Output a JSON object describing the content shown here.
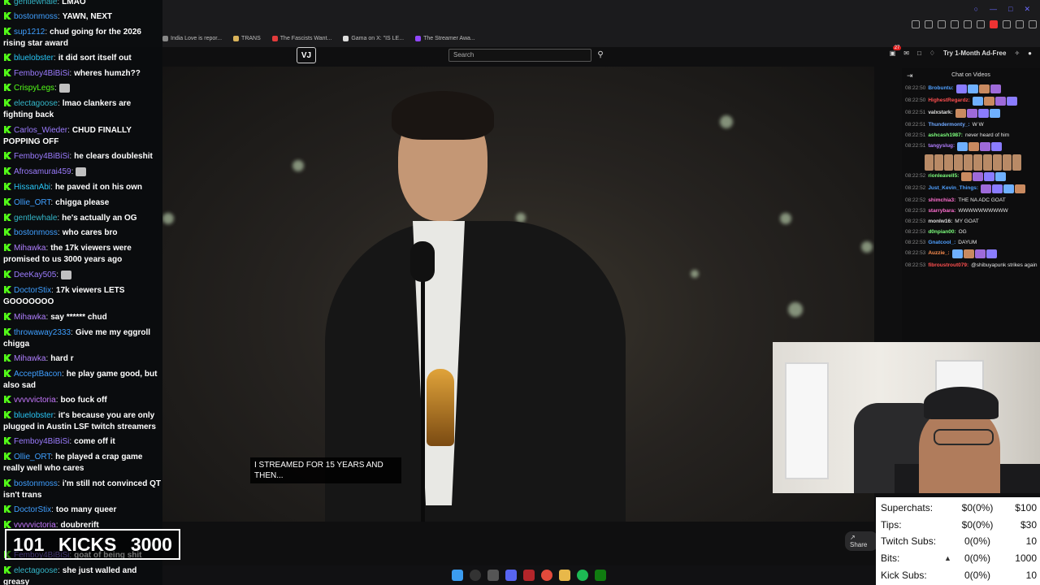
{
  "browser": {
    "bookmarks": [
      "India Love is repor...",
      "TRANS",
      "The Fascists Want...",
      "Gama on X: \"IS LE...",
      "The Streamer Awa..."
    ]
  },
  "header": {
    "logo": "VJ",
    "search_placeholder": "Search",
    "notification_count": "27",
    "ad_free_label": "Try 1-Month Ad-Free"
  },
  "video": {
    "subtitle": "I STREAMED FOR 15 YEARS AND THEN..."
  },
  "video_chat": {
    "title": "Chat on Videos",
    "messages": [
      {
        "time": "08:22:50",
        "user": "Brobuntu:",
        "text": "",
        "color": "#4fa0ff"
      },
      {
        "time": "08:22:50",
        "user": "HighestRegardz:",
        "text": "",
        "color": "#ff4f4f"
      },
      {
        "time": "08:22:51",
        "user": "valxstark:",
        "text": "",
        "color": "#e0e0e0"
      },
      {
        "time": "08:22:51",
        "user": "Thundermonty_:",
        "text": "W W",
        "color": "#6fa8ff"
      },
      {
        "time": "08:22:51",
        "user": "ashcash1987:",
        "text": "never heard of him",
        "color": "#7dff7d"
      },
      {
        "time": "08:22:51",
        "user": "tangyslug:",
        "text": "",
        "color": "#b27dff"
      },
      {
        "time": "08:22:52",
        "user": "rionleavell5:",
        "text": "",
        "color": "#7dff7d"
      },
      {
        "time": "08:22:52",
        "user": "Just_Kevin_Things:",
        "text": "",
        "color": "#4fa0ff"
      },
      {
        "time": "08:22:52",
        "user": "shimchia3:",
        "text": "THE NA ADC GOAT",
        "color": "#ff6fd0"
      },
      {
        "time": "08:22:53",
        "user": "starrybara:",
        "text": "WWWWWWWWWW",
        "color": "#ff6fd0"
      },
      {
        "time": "08:22:53",
        "user": "monlw16:",
        "text": "MY GOAT",
        "color": "#e0e0e0"
      },
      {
        "time": "08:22:53",
        "user": "d0npian00:",
        "text": "OG",
        "color": "#7dff7d"
      },
      {
        "time": "08:22:53",
        "user": "Gnatcool_:",
        "text": "DAYUM",
        "color": "#4fa0ff"
      },
      {
        "time": "08:22:53",
        "user": "Auzzie_:",
        "text": "",
        "color": "#ff8f4f"
      },
      {
        "time": "08:22:53",
        "user": "fibroustrout079:",
        "text": "@shibuyapunk strikes again",
        "color": "#ff4f4f"
      }
    ]
  },
  "left_chat": {
    "messages": [
      {
        "user": "gentlewhale",
        "text": "LMAO",
        "cls": "u-teal"
      },
      {
        "user": "bostonmoss",
        "text": "YAWN, NEXT",
        "cls": "u-blue"
      },
      {
        "user": "sup1212",
        "text": "chud going for the 2026 rising star award",
        "cls": "u-blue"
      },
      {
        "user": "bluelobster",
        "text": "it did sort itself out",
        "cls": "u-cyan"
      },
      {
        "user": "Femboy4BiBiSi",
        "text": "wheres humzh??",
        "cls": "u-purple"
      },
      {
        "user": "CrispyLegs",
        "text": "",
        "cls": "u-green"
      },
      {
        "user": "electagoose",
        "text": "lmao clankers are fighting back",
        "cls": "u-teal"
      },
      {
        "user": "Carlos_Wieder",
        "text": "CHUD FINALLY POPPING OFF",
        "cls": "u-purple"
      },
      {
        "user": "Femboy4BiBiSi",
        "text": "he clears doubleshit",
        "cls": "u-purple"
      },
      {
        "user": "Afrosamurai459",
        "text": "",
        "cls": "u-purple"
      },
      {
        "user": "HissanAbi",
        "text": "he paved it on his own",
        "cls": "u-cyan"
      },
      {
        "user": "Ollie_ORT",
        "text": "chigga please",
        "cls": "u-blue"
      },
      {
        "user": "gentlewhale",
        "text": "he's actually an OG",
        "cls": "u-teal"
      },
      {
        "user": "bostonmoss",
        "text": "who cares bro",
        "cls": "u-blue"
      },
      {
        "user": "Mihawka",
        "text": "the 17k viewers were promised to us 3000 years ago",
        "cls": "u-violet"
      },
      {
        "user": "DeeKay505",
        "text": "",
        "cls": "u-purple"
      },
      {
        "user": "DoctorStix",
        "text": "17k viewers LETS GOOOOOOO",
        "cls": "u-blue"
      },
      {
        "user": "Mihawka",
        "text": "say ****** chud",
        "cls": "u-violet"
      },
      {
        "user": "throwaway2333",
        "text": "Give me my eggroll chigga",
        "cls": "u-blue"
      },
      {
        "user": "Mihawka",
        "text": "hard r",
        "cls": "u-violet"
      },
      {
        "user": "AcceptBacon",
        "text": "he play game good, but also sad",
        "cls": "u-blue"
      },
      {
        "user": "vvvvvictoria",
        "text": "boo fuck off",
        "cls": "u-mag"
      },
      {
        "user": "bluelobster",
        "text": "it's because you are only plugged in Austin LSF twitch streamers",
        "cls": "u-cyan"
      },
      {
        "user": "Femboy4BiBiSi",
        "text": "come off it",
        "cls": "u-purple"
      },
      {
        "user": "Ollie_ORT",
        "text": "he played a crap game really well who cares",
        "cls": "u-blue"
      },
      {
        "user": "bostonmoss",
        "text": "i'm still not convinced QT isn't trans",
        "cls": "u-blue"
      },
      {
        "user": "DoctorStix",
        "text": "too many queer",
        "cls": "u-blue"
      },
      {
        "user": "vvvvvictoria",
        "text": "doubrerift",
        "cls": "u-mag"
      },
      {
        "user": "Femboy4BiBiSi",
        "text": "goat of being shit",
        "cls": "u-purple"
      },
      {
        "user": "electagoose",
        "text": "she just walled and greasy",
        "cls": "u-teal"
      }
    ]
  },
  "kicks": {
    "current": "101",
    "label": "KICKS",
    "goal": "3000"
  },
  "bottom": {
    "share_label": "Share"
  },
  "stats": [
    {
      "label": "Superchats:",
      "value": "$0(0%)",
      "goal": "$100"
    },
    {
      "label": "Tips:",
      "value": "$0(0%)",
      "goal": "$30"
    },
    {
      "label": "Twitch Subs:",
      "value": "0(0%)",
      "goal": "10"
    },
    {
      "label": "Bits:",
      "value": "0(0%)",
      "goal": "1000"
    },
    {
      "label": "Kick Subs:",
      "value": "0(0%)",
      "goal": "10"
    }
  ]
}
